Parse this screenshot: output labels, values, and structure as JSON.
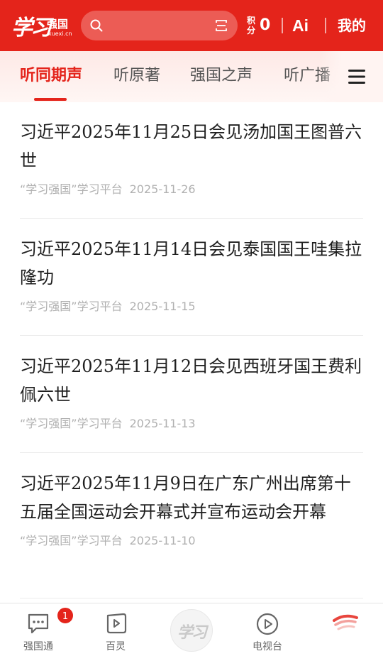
{
  "header": {
    "logo_main": "学习",
    "logo_sub": "强国",
    "logo_url": "xuexi.cn",
    "points_label": "积分",
    "points_value": "0",
    "ai_label": "Ai",
    "mine_label": "我的",
    "search_placeholder": "",
    "brand_color": "#e4241b"
  },
  "tabs": [
    {
      "label": "听同期声",
      "active": true
    },
    {
      "label": "听原著",
      "active": false
    },
    {
      "label": "强国之声",
      "active": false
    },
    {
      "label": "听广播",
      "active": false
    }
  ],
  "articles": [
    {
      "title": "习近平2025年11月25日会见汤加国王图普六世",
      "source": "“学习强国”学习平台",
      "date": "2025-11-26"
    },
    {
      "title": "习近平2025年11月14日会见泰国国王哇集拉隆功",
      "source": "“学习强国”学习平台",
      "date": "2025-11-15"
    },
    {
      "title": "习近平2025年11月12日会见西班牙国王费利佩六世",
      "source": "“学习强国”学习平台",
      "date": "2025-11-13"
    },
    {
      "title": "习近平2025年11月9日在广东广州出席第十五届全国运动会开幕式并宣布运动会开幕",
      "source": "“学习强国”学习平台",
      "date": "2025-11-10"
    }
  ],
  "bottom_nav": {
    "qiangguotong": "强国通",
    "badge": "1",
    "bailing": "百灵",
    "center_logo": "学习",
    "tv": "电视台"
  }
}
